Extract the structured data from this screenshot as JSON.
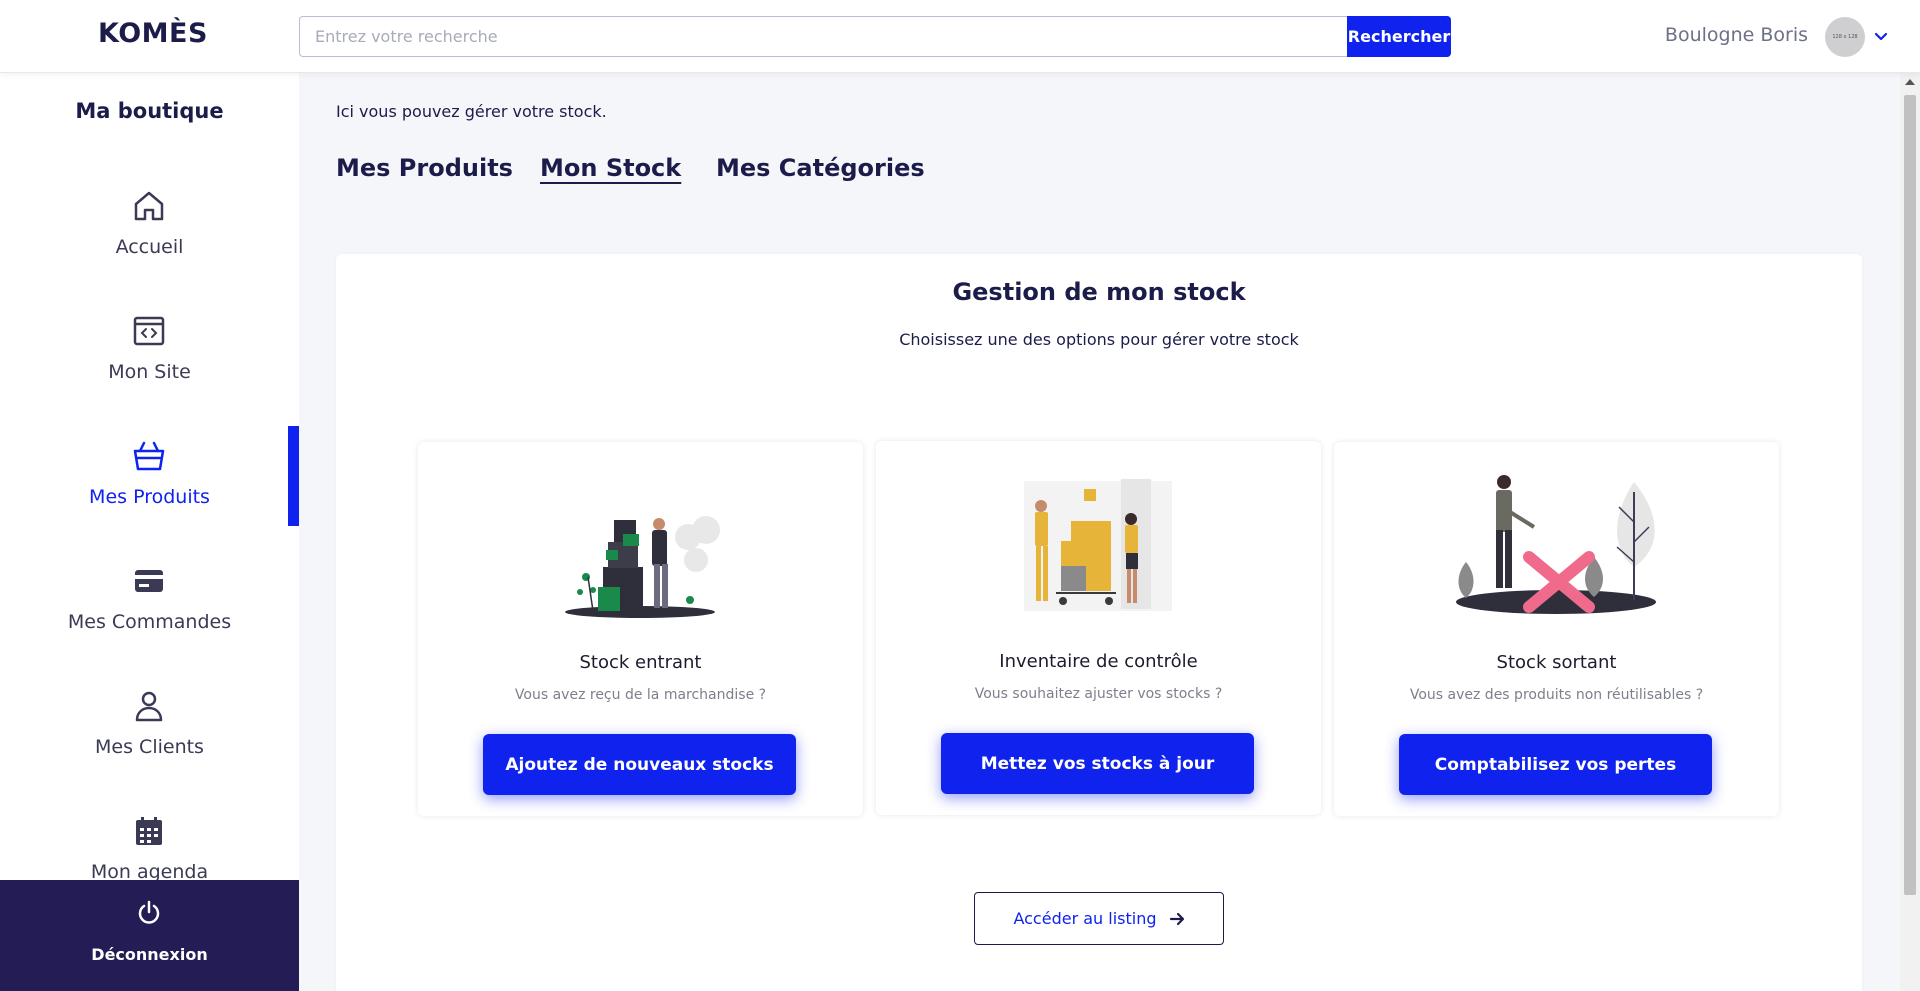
{
  "header": {
    "logo": "KOMÈS",
    "search_placeholder": "Entrez votre recherche",
    "search_button": "Rechercher",
    "user_name": "Boulogne Boris",
    "avatar_text": "128 x 128"
  },
  "sidebar": {
    "title": "Ma boutique",
    "items": [
      {
        "label": "Accueil",
        "icon": "home-icon"
      },
      {
        "label": "Mon Site",
        "icon": "code-window-icon"
      },
      {
        "label": "Mes Produits",
        "icon": "basket-icon",
        "active": true
      },
      {
        "label": "Mes Commandes",
        "icon": "credit-card-icon"
      },
      {
        "label": "Mes Clients",
        "icon": "user-icon"
      },
      {
        "label": "Mon agenda",
        "icon": "calendar-icon"
      }
    ],
    "logout": "Déconnexion"
  },
  "main": {
    "intro": "Ici vous pouvez gérer votre stock.",
    "tabs": [
      {
        "label": "Mes Produits"
      },
      {
        "label": "Mon Stock",
        "active": true
      },
      {
        "label": "Mes Catégories"
      }
    ],
    "panel": {
      "title": "Gestion de mon stock",
      "subtitle": "Choisissez une des options pour gérer votre stock",
      "cards": [
        {
          "title": "Stock entrant",
          "desc": "Vous avez reçu de la marchandise ?",
          "button": "Ajoutez de nouveaux stocks"
        },
        {
          "title": "Inventaire de contrôle",
          "desc": "Vous souhaitez ajuster vos stocks ?",
          "button": "Mettez vos stocks à jour"
        },
        {
          "title": "Stock sortant",
          "desc": "Vous avez des produits non réutilisables ?",
          "button": "Comptabilisez vos pertes"
        }
      ],
      "listing_button": "Accéder au listing"
    }
  },
  "colors": {
    "accent": "#0f22ee",
    "navy": "#1c1c4a",
    "logout_bg": "#231c55",
    "background": "#f5f6fa"
  }
}
